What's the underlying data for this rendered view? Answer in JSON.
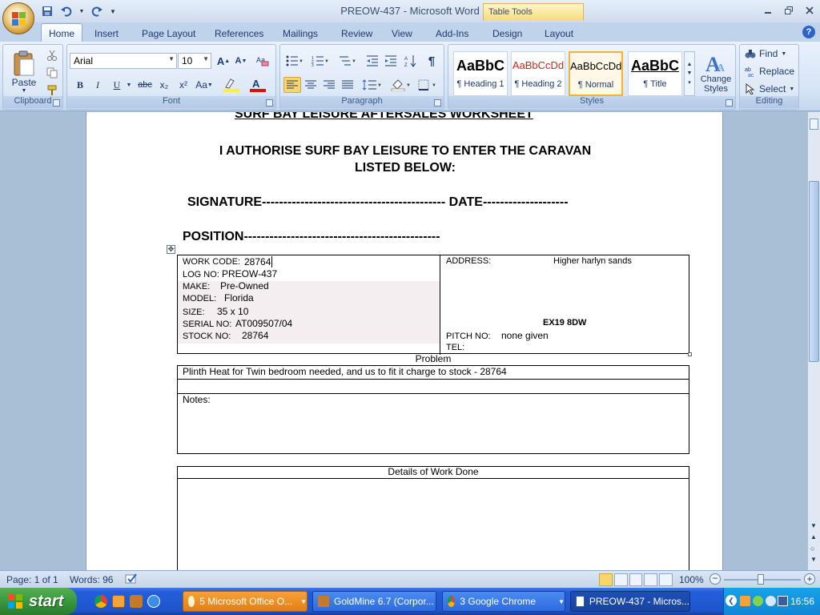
{
  "title_bar": {
    "document_title": "PREOW-437 - Microsoft Word",
    "table_tools": "Table Tools"
  },
  "tabs": [
    "Home",
    "Insert",
    "Page Layout",
    "References",
    "Mailings",
    "Review",
    "View",
    "Add-Ins",
    "Design",
    "Layout"
  ],
  "ribbon": {
    "clipboard": {
      "label": "Clipboard",
      "paste": "Paste"
    },
    "font": {
      "label": "Font",
      "font_name": "Arial",
      "font_size": "10",
      "bold": "B",
      "italic": "I",
      "underline": "U",
      "strike": "abc",
      "subscript": "x₂",
      "superscript": "x²",
      "change_case": "Aa"
    },
    "paragraph": {
      "label": "Paragraph"
    },
    "styles": {
      "label": "Styles",
      "items": [
        {
          "preview": "AaBbC",
          "name": "¶ Heading 1"
        },
        {
          "preview": "AaBbCcDd",
          "name": "¶ Heading 2"
        },
        {
          "preview": "AaBbCcDd",
          "name": "¶ Normal"
        },
        {
          "preview": "AaBbC",
          "name": "¶ Title"
        }
      ],
      "change_styles": "Change Styles"
    },
    "editing": {
      "label": "Editing",
      "find": "Find",
      "replace": "Replace",
      "select": "Select"
    }
  },
  "document": {
    "cut_heading": "SURF BAY LEISURE AFTERSALES WORKSHEET",
    "authorise_line1": "I AUTHORISE SURF BAY LEISURE TO ENTER THE CARAVAN",
    "authorise_line2": "LISTED BELOW:",
    "signature": "SIGNATURE------------------------------------------- DATE--------------------",
    "position": "POSITION----------------------------------------------",
    "info": {
      "work_code_label": "WORK CODE:",
      "work_code": "28764",
      "log_no_label": "LOG NO:",
      "log_no": "PREOW-437",
      "make_label": "MAKE:",
      "make": "Pre-Owned",
      "model_label": "MODEL:",
      "model": "Florida",
      "size_label": "SIZE:",
      "size": "35 x 10",
      "serial_label": "SERIAL NO:",
      "serial": "AT009507/04",
      "stock_label": "STOCK NO:",
      "stock": "28764",
      "address_label": "ADDRESS:",
      "address": "Higher harlyn sands",
      "postcode": "EX19 8DW",
      "pitch_label": "PITCH NO:",
      "pitch": "none given",
      "tel_label": "TEL:"
    },
    "problem_label": "Problem",
    "problem_text": "Plinth Heat for Twin bedroom needed, and us to fit it charge to stock - 28764",
    "notes_label": "Notes:",
    "details_label": "Details of Work Done"
  },
  "status_bar": {
    "page": "Page: 1 of 1",
    "words": "Words: 96",
    "zoom": "100%"
  },
  "taskbar": {
    "start": "start",
    "buttons": [
      {
        "label": "5 Microsoft Office O..."
      },
      {
        "label": "GoldMine 6.7 (Corpor..."
      },
      {
        "label": "3 Google Chrome"
      },
      {
        "label": "PREOW-437 - Micros..."
      }
    ],
    "clock": "16:56"
  },
  "colors": {
    "ribbon_bg": "#d6e4f5",
    "taskbar_blue": "#245edb",
    "start_green": "#36923a",
    "active_style_border": "#f2b233"
  }
}
